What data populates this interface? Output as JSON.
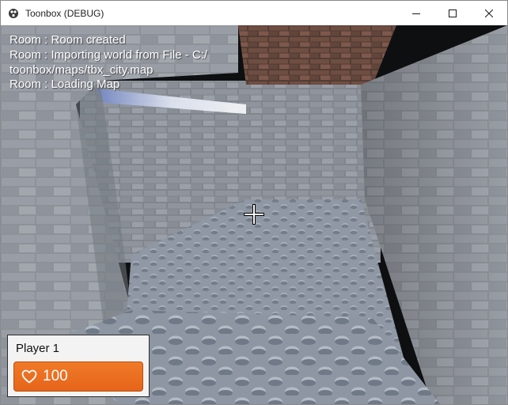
{
  "window": {
    "title": "Toonbox (DEBUG)",
    "icons": {
      "app": "app-logo-icon",
      "minimize": "minimize-icon",
      "maximize": "maximize-icon",
      "close": "close-icon"
    }
  },
  "console": {
    "lines": [
      "Room : Room created",
      "Room : Importing world from File - C:/\ntoonbox/maps/tbx_city.map",
      "Room : Loading Map"
    ]
  },
  "hud": {
    "player_name": "Player 1",
    "health": "100",
    "health_icon": "heart-icon",
    "crosshair_icon": "crosshair-icon",
    "colors": {
      "health_bar": "#eb6b20",
      "panel_bg": "#f3f3f3"
    }
  }
}
